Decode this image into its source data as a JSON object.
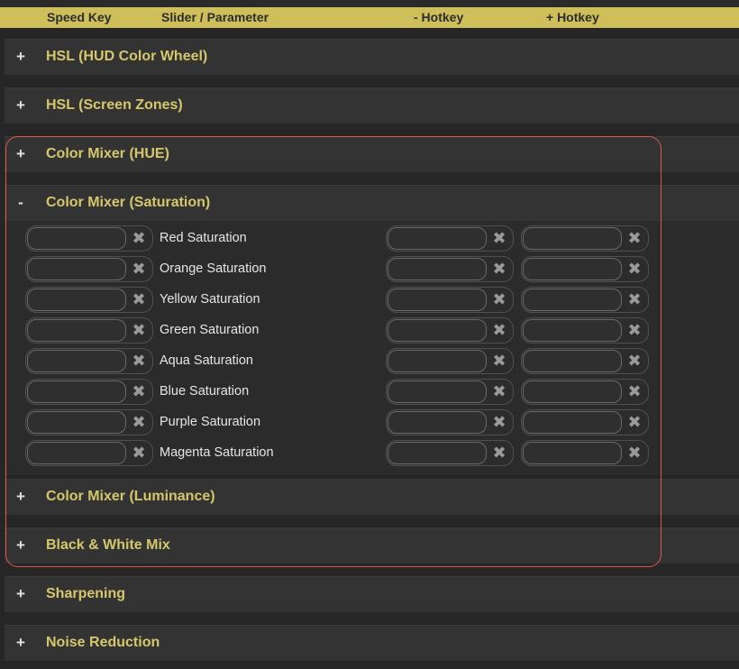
{
  "header": {
    "speed_key": "Speed Key",
    "slider_parameter": "Slider / Parameter",
    "minus_hotkey": "- Hotkey",
    "plus_hotkey": "+ Hotkey"
  },
  "sections": [
    {
      "toggle": "+",
      "title": "HSL (HUD Color Wheel)"
    },
    {
      "toggle": "+",
      "title": "HSL (Screen Zones)"
    },
    {
      "toggle": "+",
      "title": "Color Mixer (HUE)"
    },
    {
      "toggle": "-",
      "title": "Color Mixer (Saturation)"
    },
    {
      "toggle": "+",
      "title": "Color Mixer (Luminance)"
    },
    {
      "toggle": "+",
      "title": "Black & White Mix"
    },
    {
      "toggle": "+",
      "title": "Sharpening"
    },
    {
      "toggle": "+",
      "title": "Noise Reduction"
    }
  ],
  "saturation_rows": [
    {
      "param": "Red Saturation"
    },
    {
      "param": "Orange Saturation"
    },
    {
      "param": "Yellow Saturation"
    },
    {
      "param": "Green Saturation"
    },
    {
      "param": "Aqua Saturation"
    },
    {
      "param": "Blue Saturation"
    },
    {
      "param": "Purple Saturation"
    },
    {
      "param": "Magenta Saturation"
    }
  ],
  "clear_glyph": "✖",
  "colors": {
    "header_bg": "#cfbf5b",
    "section_title": "#d6c86a",
    "highlight_border": "#e0584a",
    "section_bg": "#333333"
  }
}
